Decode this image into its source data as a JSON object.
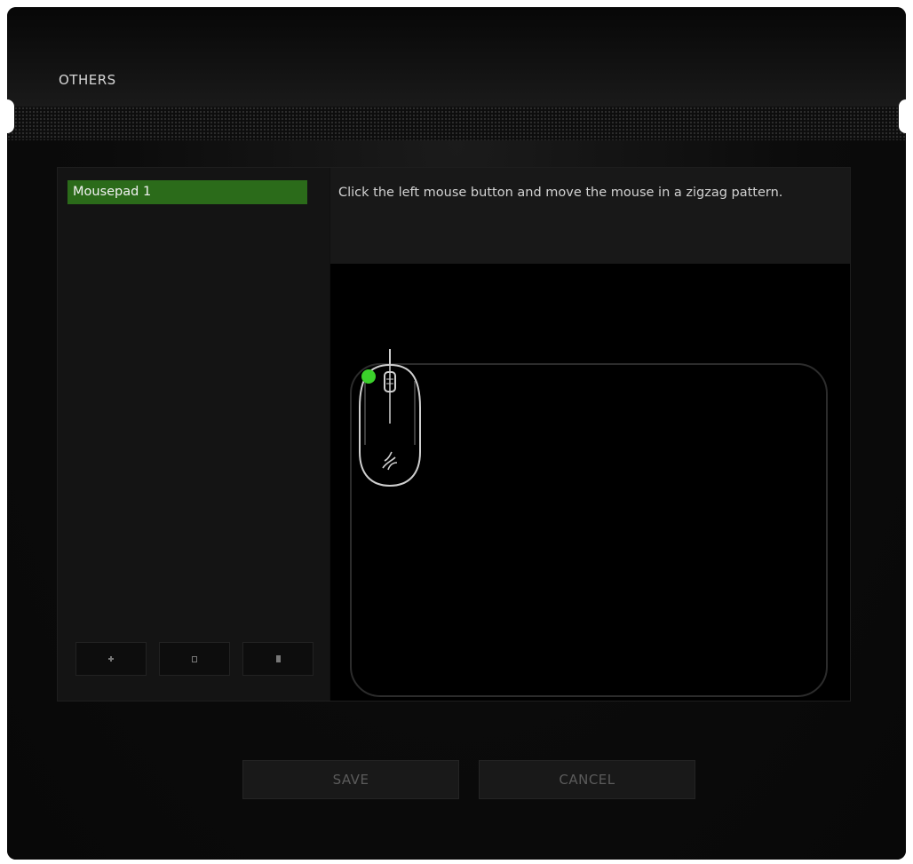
{
  "section": {
    "title": "OTHERS"
  },
  "mousepads": {
    "items": [
      {
        "label": "Mousepad 1",
        "selected": true
      }
    ]
  },
  "toolbar": {
    "buttons": [
      {
        "icon": "plus-icon"
      },
      {
        "icon": "copy-icon"
      },
      {
        "icon": "trash-icon"
      }
    ]
  },
  "calibration": {
    "instruction": "Click the left mouse button and move the mouse in a zigzag pattern.",
    "indicator_color": "#3bd12b"
  },
  "actions": {
    "save_label": "SAVE",
    "cancel_label": "CANCEL"
  },
  "colors": {
    "accent": "#2b6b1a",
    "background": "#0a0a0a"
  }
}
